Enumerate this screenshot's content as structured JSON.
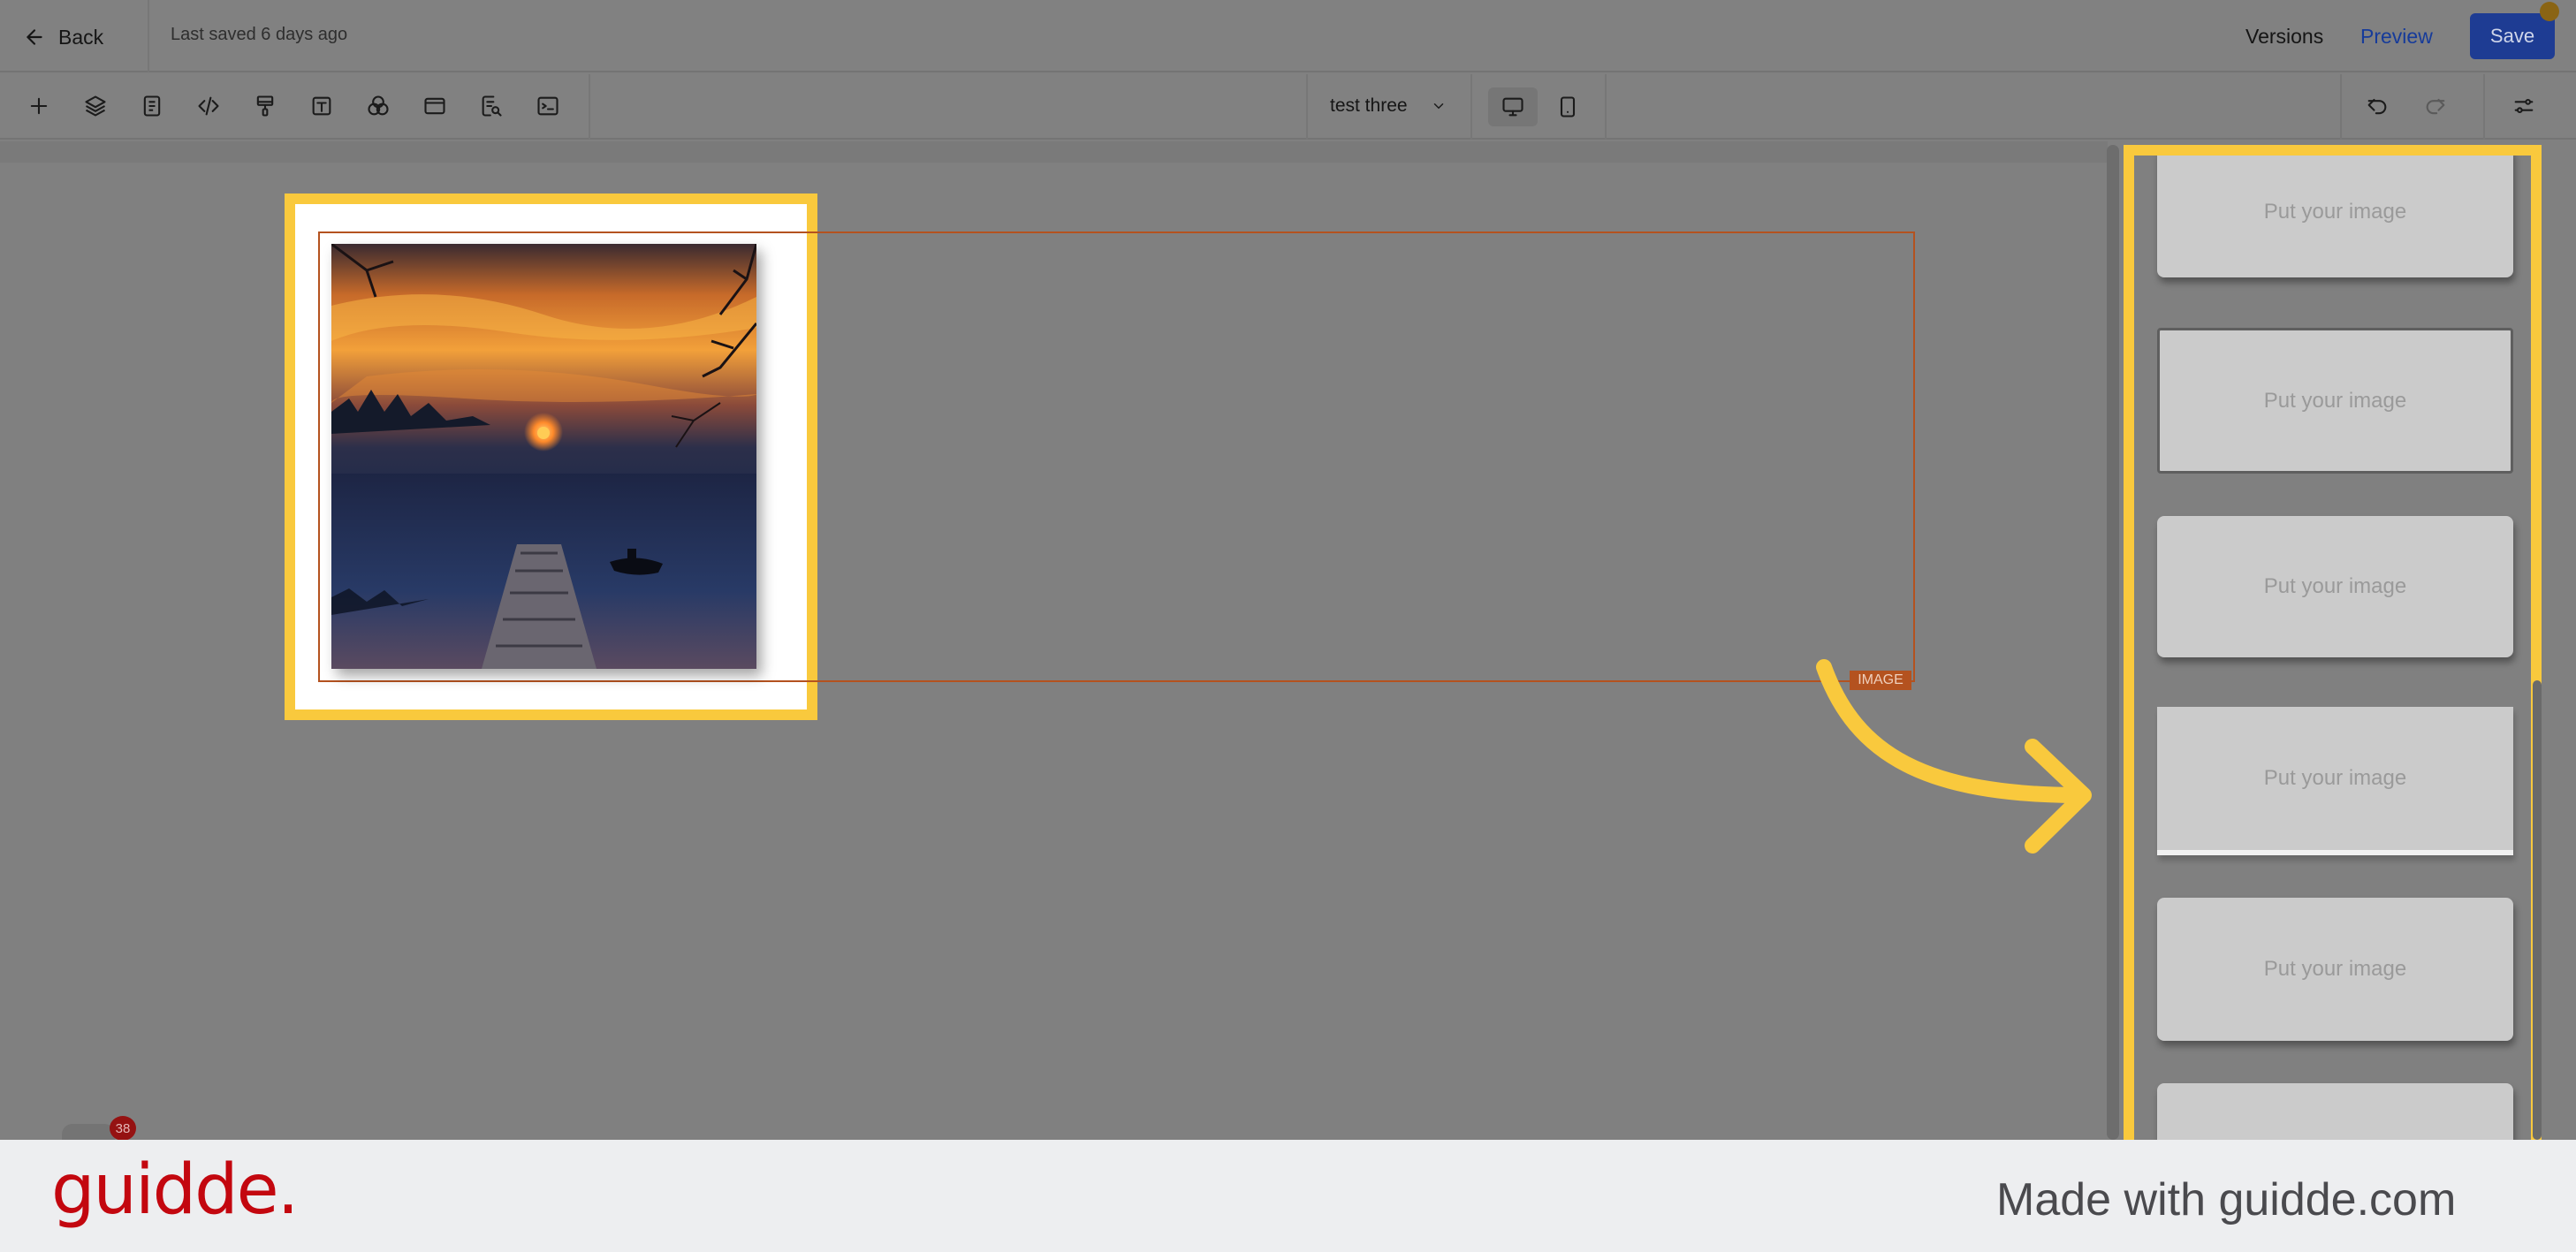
{
  "header": {
    "back_label": "Back",
    "saved_text": "Last saved 6 days ago",
    "versions_label": "Versions",
    "preview_label": "Preview",
    "save_label": "Save"
  },
  "toolbar": {
    "tools": [
      "add-icon",
      "layers-icon",
      "pages-icon",
      "code-icon",
      "paint-icon",
      "text-icon",
      "blend-icon",
      "window-icon",
      "search-doc-icon",
      "terminal-icon"
    ],
    "page_name": "test three",
    "device_options": [
      "desktop",
      "mobile"
    ],
    "active_device": "desktop"
  },
  "canvas": {
    "element_tag": "IMAGE"
  },
  "panel": {
    "templates": [
      {
        "label": "Put your image"
      },
      {
        "label": "Put your image"
      },
      {
        "label": "Put your image"
      },
      {
        "label": "Put your image"
      },
      {
        "label": "Put your image"
      }
    ]
  },
  "notification": {
    "count": "38"
  },
  "footer": {
    "logo_text": "guidde.",
    "made_with": "Made with guidde.com"
  },
  "colors": {
    "highlight": "#f9c93d",
    "frame": "#b4521f",
    "save_button": "#1e3c93",
    "brand_red": "#c3070f"
  }
}
